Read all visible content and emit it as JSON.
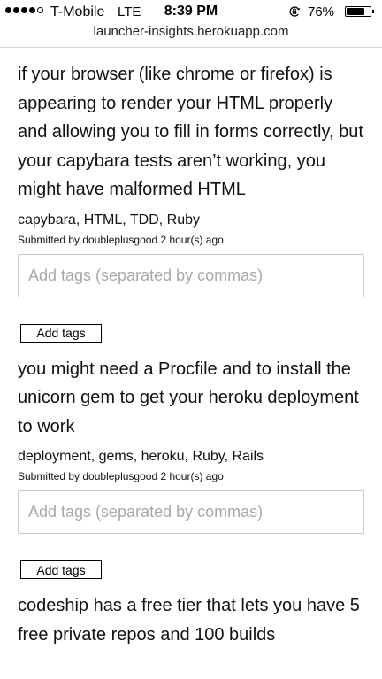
{
  "status_bar": {
    "carrier": "T-Mobile",
    "network": "LTE",
    "time": "8:39 PM",
    "battery_percent": "76%",
    "battery_level": 0.76,
    "signal_bars_filled": 4,
    "signal_bars_total": 5
  },
  "browser": {
    "url": "launcher-insights.herokuapp.com"
  },
  "posts": [
    {
      "title": "if your browser (like chrome or firefox) is appearing to render your HTML properly and allowing you to fill in forms correctly, but your capybara tests aren’t working, you might have malformed HTML",
      "tags": "capybara, HTML, TDD, Ruby",
      "meta": "Submitted by doubleplusgood 2 hour(s) ago",
      "input_placeholder": "Add tags (separated by commas)",
      "input_value": "",
      "button_label": "Add tags"
    },
    {
      "title": "you might need a Procfile and to install the unicorn gem to get your heroku deployment to work",
      "tags": "deployment, gems, heroku, Ruby, Rails",
      "meta": "Submitted by doubleplusgood 2 hour(s) ago",
      "input_placeholder": "Add tags (separated by commas)",
      "input_value": "",
      "button_label": "Add tags"
    },
    {
      "title": "codeship has a free tier that lets you have 5 free private repos and 100 builds"
    }
  ]
}
